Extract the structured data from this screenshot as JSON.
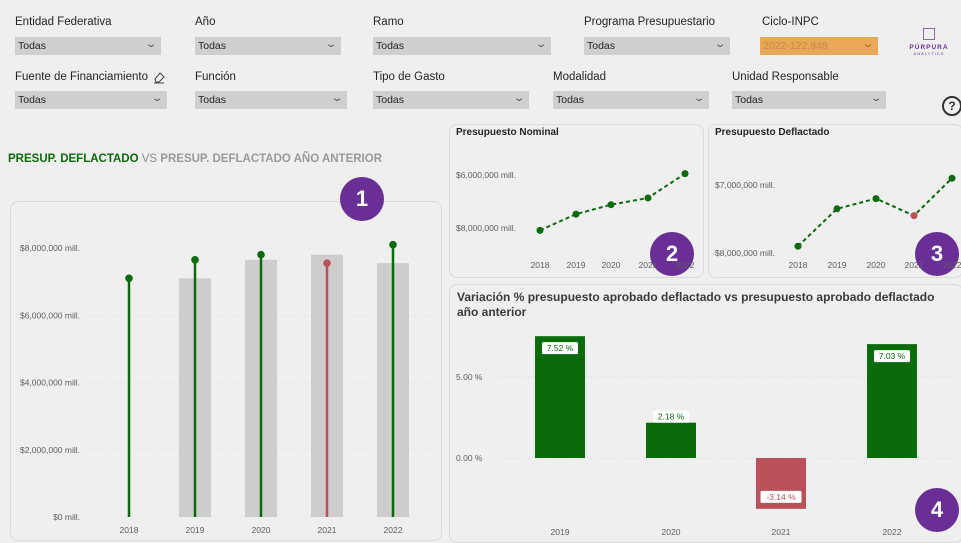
{
  "filters": {
    "row1": [
      {
        "label": "Entidad Federativa",
        "value": "Todas"
      },
      {
        "label": "Año",
        "value": "Todas"
      },
      {
        "label": "Ramo",
        "value": "Todas"
      },
      {
        "label": "Programa Presupuestario",
        "value": "Todas"
      },
      {
        "label": "Ciclo-INPC",
        "value": "2022-122.948"
      }
    ],
    "row2": [
      {
        "label": "Fuente de Financiamiento",
        "value": "Todas"
      },
      {
        "label": "Función",
        "value": "Todas"
      },
      {
        "label": "Tipo de Gasto",
        "value": "Todas"
      },
      {
        "label": "Modalidad",
        "value": "Todas"
      },
      {
        "label": "Unidad Responsable",
        "value": "Todas"
      }
    ]
  },
  "brand": {
    "name": "PÚRPURA",
    "sub": "ANALYTICS",
    "logo_icon": "purpura-logo"
  },
  "icons": {
    "eraser": "eraser-icon",
    "help": "help-icon",
    "chevron": "chevron-down-icon"
  },
  "colors": {
    "green": "#0b6a0b",
    "red": "#b9505a",
    "gray_bar": "#cdcdcd",
    "badge": "#6a2f97",
    "accent": "#e8a858"
  },
  "main_title": {
    "part1": "PRESUP. DEFLACTADO",
    "part2": " VS ",
    "part3": "PRESUP. DEFLACTADO AÑO ANTERIOR"
  },
  "badges": [
    "1",
    "2",
    "3",
    "4"
  ],
  "chart_data": [
    {
      "type": "bar",
      "title": "PRESUP. DEFLACTADO VS PRESUP. DEFLACTADO AÑO ANTERIOR",
      "categories": [
        "2018",
        "2019",
        "2020",
        "2021",
        "2022"
      ],
      "series": [
        {
          "name": "PRESUP. DEFLACTADO",
          "values": [
            7100000,
            7650000,
            7800000,
            7550000,
            8100000
          ]
        },
        {
          "name": "PRESUP. DEFLACTADO AÑO ANTERIOR",
          "values": [
            null,
            7100000,
            7650000,
            7800000,
            7550000
          ]
        }
      ],
      "yticks": [
        "$0 mill.",
        "$2,000,000 mill.",
        "$4,000,000 mill.",
        "$6,000,000 mill.",
        "$8,000,000 mill."
      ],
      "ylim": [
        0,
        8600000
      ],
      "highlight_category": "2021"
    },
    {
      "type": "line",
      "title": "Presupuesto Nominal",
      "categories": [
        "2018",
        "2019",
        "2020",
        "2021",
        "2022"
      ],
      "values": [
        5950000,
        6550000,
        6900000,
        7150000,
        8050000
      ],
      "yticks": [
        "$6,000,000 mill.",
        "$8,000,000 mill."
      ],
      "ylim": [
        5400000,
        8500000
      ]
    },
    {
      "type": "line",
      "title": "Presupuesto Deflactado",
      "categories": [
        "2018",
        "2019",
        "2020",
        "2021",
        "2022"
      ],
      "values": [
        7100000,
        7650000,
        7800000,
        7550000,
        8100000
      ],
      "yticks": [
        "$7,000,000 mill.",
        "$8,000,000 mill."
      ],
      "ylim": [
        6800000,
        8450000
      ],
      "highlight_category": "2021"
    },
    {
      "type": "bar",
      "title": "Variación % presupuesto aprobado deflactado vs presupuesto aprobado deflactado año anterior",
      "categories": [
        "2019",
        "2020",
        "2021",
        "2022"
      ],
      "values": [
        7.52,
        2.18,
        -3.14,
        7.03
      ],
      "data_labels": [
        "7.52 %",
        "2.18 %",
        "-3.14 %",
        "7.03 %"
      ],
      "yticks": [
        "0.00 %",
        "5.00 %"
      ],
      "ylim": [
        -4.1,
        9.4
      ]
    }
  ]
}
